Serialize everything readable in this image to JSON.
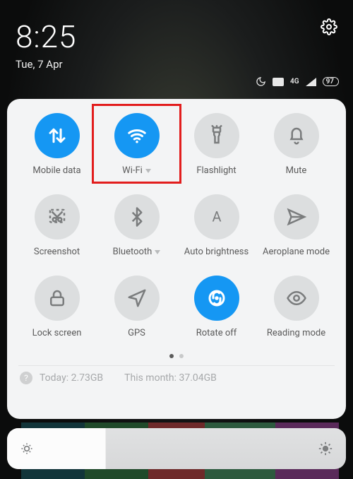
{
  "clock": {
    "time": "8:25",
    "date": "Tue, 7 Apr"
  },
  "status": {
    "network": "4G",
    "battery": "97"
  },
  "tiles": [
    {
      "id": "mobile-data",
      "label": "Mobile data",
      "active": true,
      "icon": "updown",
      "caret": false
    },
    {
      "id": "wifi",
      "label": "Wi-Fi",
      "active": true,
      "icon": "wifi",
      "caret": true,
      "highlighted": true
    },
    {
      "id": "flashlight",
      "label": "Flashlight",
      "active": false,
      "icon": "torch",
      "caret": false
    },
    {
      "id": "mute",
      "label": "Mute",
      "active": false,
      "icon": "bell",
      "caret": false
    },
    {
      "id": "screenshot",
      "label": "Screenshot",
      "active": false,
      "icon": "scissors",
      "caret": false
    },
    {
      "id": "bluetooth",
      "label": "Bluetooth",
      "active": false,
      "icon": "bt",
      "caret": true
    },
    {
      "id": "auto-bright",
      "label": "Auto brightness",
      "active": false,
      "icon": "autoA",
      "caret": false
    },
    {
      "id": "airplane",
      "label": "Aeroplane mode",
      "active": false,
      "icon": "plane",
      "caret": false
    },
    {
      "id": "lock",
      "label": "Lock screen",
      "active": false,
      "icon": "lock",
      "caret": false
    },
    {
      "id": "gps",
      "label": "GPS",
      "active": false,
      "icon": "nav",
      "caret": false
    },
    {
      "id": "rotate",
      "label": "Rotate off",
      "active": true,
      "icon": "rotate",
      "caret": false
    },
    {
      "id": "reading",
      "label": "Reading mode",
      "active": false,
      "icon": "eye",
      "caret": false
    }
  ],
  "usage": {
    "today_label": "Today:",
    "today": "2.73GB",
    "month_label": "This month:",
    "month": "37.04GB"
  },
  "colors": {
    "accent": "#1597f3",
    "highlight": "#e21d1d"
  }
}
